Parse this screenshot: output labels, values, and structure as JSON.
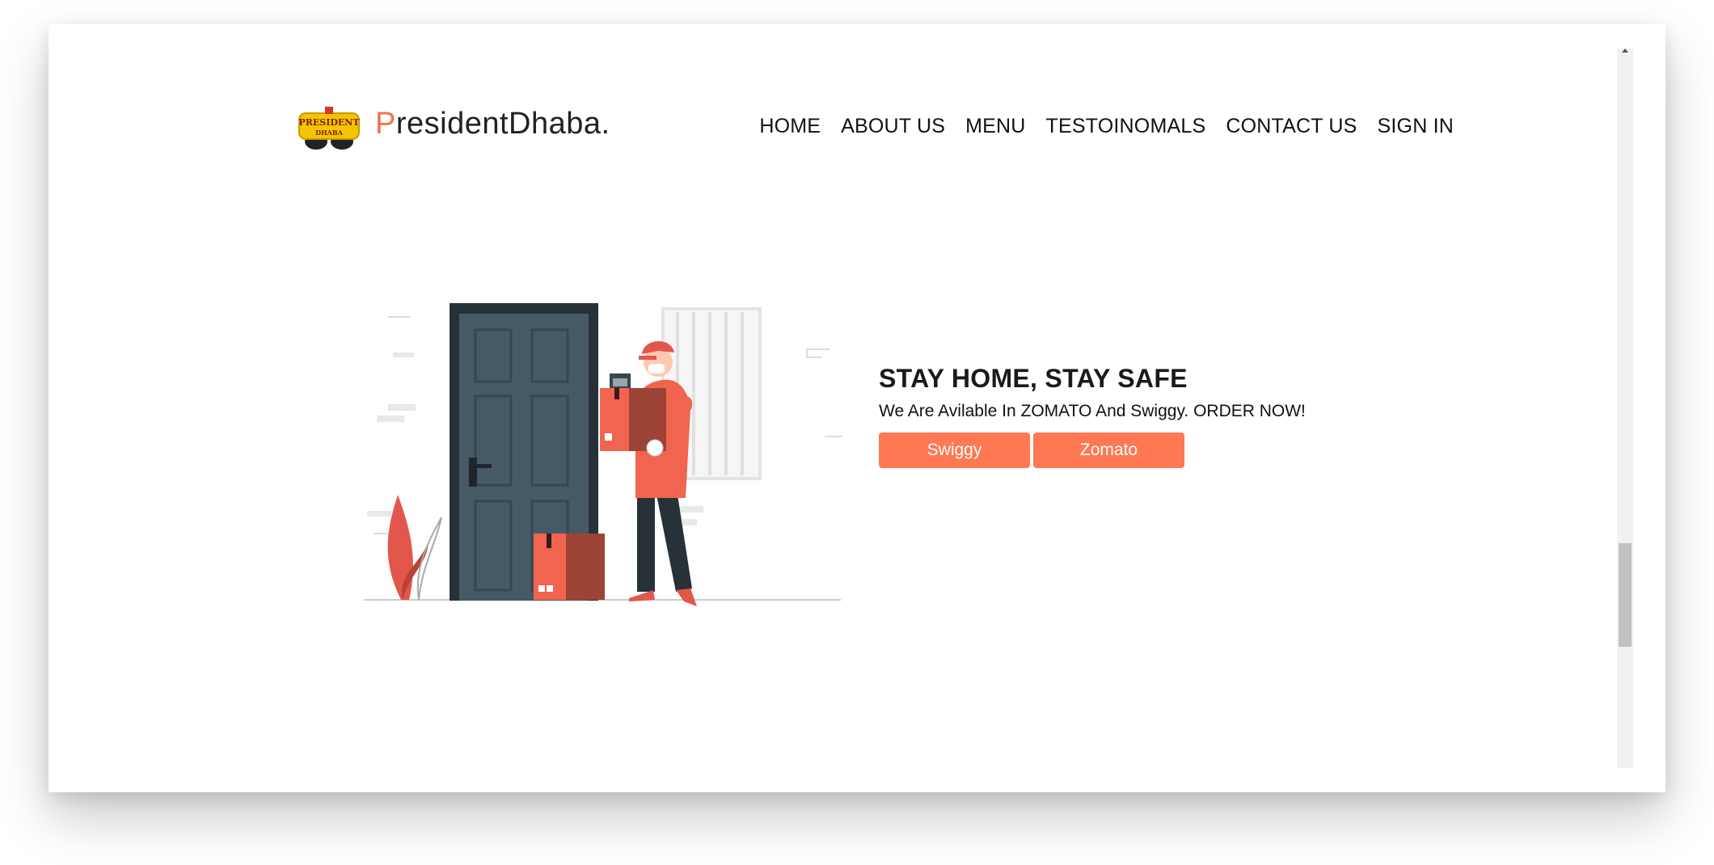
{
  "brand": {
    "logo_text_top": "PRESIDENT",
    "logo_text_bottom": "DHABA",
    "name_first_letter": "P",
    "name_rest": "residentDhaba."
  },
  "nav": {
    "items": [
      {
        "label": "HOME"
      },
      {
        "label": "ABOUT US"
      },
      {
        "label": "MENU"
      },
      {
        "label": "TESTOINOMALS"
      },
      {
        "label": "CONTACT US"
      },
      {
        "label": "SIGN IN"
      }
    ]
  },
  "hero": {
    "title": "STAY HOME, STAY SAFE",
    "subtitle": "We Are Avilable In ZOMATO And Swiggy. ORDER NOW!",
    "buttons": [
      {
        "label": "Swiggy"
      },
      {
        "label": "Zomato"
      }
    ]
  },
  "colors": {
    "accent": "#fd7853",
    "brand_orange": "#f2744f",
    "logo_yellow": "#f5c400",
    "door": "#43545f",
    "box_red": "#f06450"
  }
}
